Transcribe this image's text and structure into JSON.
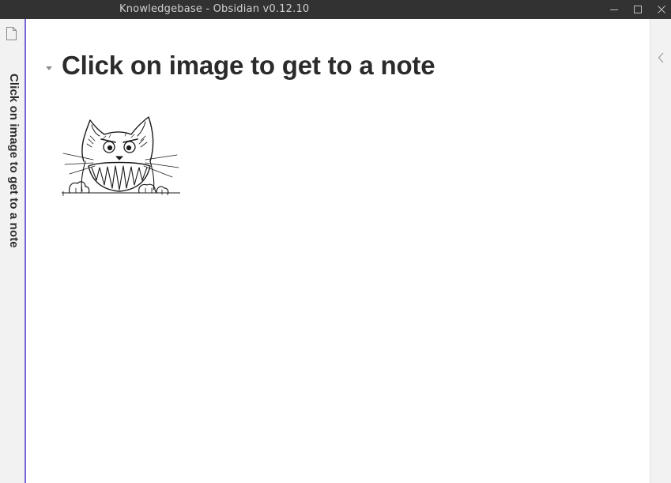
{
  "window": {
    "title": "Knowledgebase - Obsidian v0.12.10"
  },
  "sidebar": {
    "file_icon": "file-icon",
    "vertical_title": "Click on image to get to a note"
  },
  "note": {
    "heading": "Click on image to get to a note",
    "image": {
      "alt": "cat sketch",
      "icon": "cat-drawing"
    }
  },
  "right_sidebar": {
    "toggle_icon": "chevron-left-icon"
  },
  "colors": {
    "titlebar": "#323232",
    "accent": "#7a63d6",
    "sidebar_bg": "#f2f2f2"
  }
}
